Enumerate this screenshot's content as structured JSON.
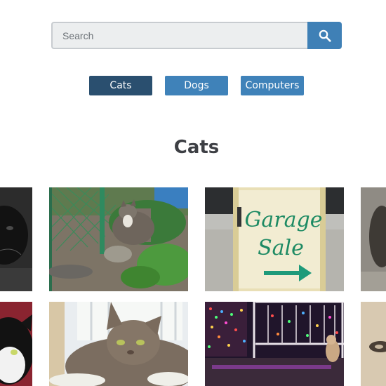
{
  "search": {
    "placeholder": "Search",
    "icon": "search-icon"
  },
  "filters": [
    {
      "label": "Cats",
      "active": true
    },
    {
      "label": "Dogs",
      "active": false
    },
    {
      "label": "Computers",
      "active": false
    }
  ],
  "gallery": {
    "heading": "Cats",
    "photos": [
      {
        "subject": "black cat"
      },
      {
        "subject": "tabby cat in garden by fence"
      },
      {
        "subject": "garage sale sign",
        "sign_text": [
          "Garage",
          "Sale"
        ]
      },
      {
        "subject": "cat on pavement"
      },
      {
        "subject": "black and white cat"
      },
      {
        "subject": "tabby cat lounging in sun"
      },
      {
        "subject": "porch with colorful lights and cat"
      },
      {
        "subject": "cat on sand"
      }
    ]
  },
  "colors": {
    "accent": "#3f80b6",
    "active": "#2a4f6f",
    "heading": "#3d3f44"
  }
}
